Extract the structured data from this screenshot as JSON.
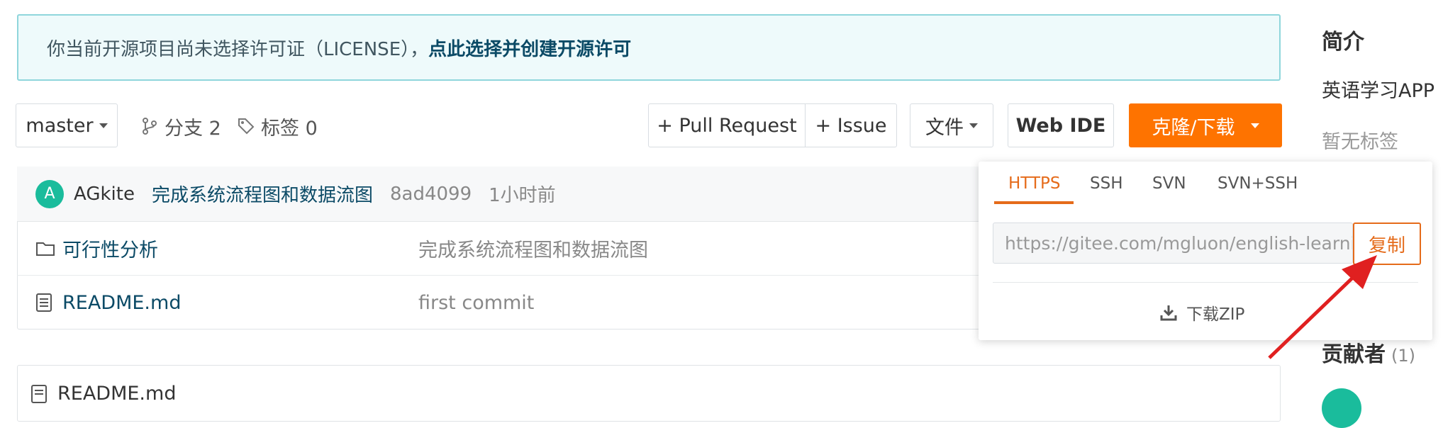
{
  "banner": {
    "text": "你当前开源项目尚未选择许可证（LICENSE），",
    "link": "点此选择并创建开源许可"
  },
  "toolbar": {
    "branch": "master",
    "branches": "分支 2",
    "tags": "标签 0",
    "pull_request": "+ Pull Request",
    "issue": "+ Issue",
    "file_menu": "文件",
    "web_ide": "Web IDE",
    "clone": "克隆/下载"
  },
  "commit": {
    "avatar_letter": "A",
    "author": "AGkite",
    "message": "完成系统流程图和数据流图",
    "hash": "8ad4099",
    "time": "1小时前"
  },
  "files": [
    {
      "name": "可行性分析",
      "message": "完成系统流程图和数据流图",
      "icon": "folder-icon"
    },
    {
      "name": "README.md",
      "message": "first commit",
      "icon": "file-doc-icon"
    }
  ],
  "readme": {
    "title": "README.md"
  },
  "clone_dropdown": {
    "tabs": [
      "HTTPS",
      "SSH",
      "SVN",
      "SVN+SSH"
    ],
    "url": "https://gitee.com/mgluon/english-learning-app.git",
    "copy": "复制",
    "download_zip": "下载ZIP"
  },
  "sidebar": {
    "intro_title": "简介",
    "description": "英语学习APP",
    "no_tags": "暂无标签",
    "contributors_title": "贡献者",
    "contributors_count": "(1)"
  },
  "colors": {
    "accent": "#fe7300",
    "link": "#0b4a66",
    "annotation_arrow": "#e02020"
  }
}
